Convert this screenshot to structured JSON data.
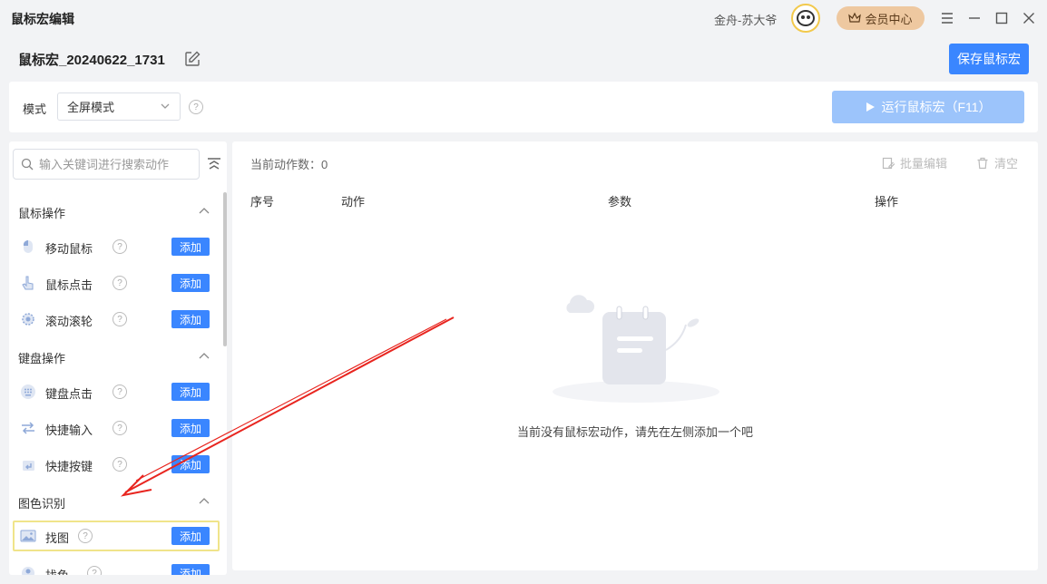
{
  "app": {
    "title": "鼠标宏编辑",
    "username": "金舟-苏大爷",
    "vip_label": "会员中心"
  },
  "header": {
    "macro_name": "鼠标宏_20240622_1731",
    "save_label": "保存鼠标宏"
  },
  "modebar": {
    "mode_label": "模式",
    "mode_value": "全屏模式",
    "run_label": "运行鼠标宏（F11）"
  },
  "sidebar": {
    "search_placeholder": "输入关键词进行搜索动作",
    "add_label": "添加",
    "groups": [
      {
        "title": "鼠标操作",
        "items": [
          {
            "label": "移动鼠标",
            "icon": "mouse-icon"
          },
          {
            "label": "鼠标点击",
            "icon": "pointer-hand-icon"
          },
          {
            "label": "滚动滚轮",
            "icon": "scroll-wheel-icon"
          }
        ]
      },
      {
        "title": "键盘操作",
        "items": [
          {
            "label": "键盘点击",
            "icon": "keyboard-icon"
          },
          {
            "label": "快捷输入",
            "icon": "quick-input-icon"
          },
          {
            "label": "快捷按键",
            "icon": "hotkey-icon"
          }
        ]
      },
      {
        "title": "图色识别",
        "items": [
          {
            "label": "找图",
            "icon": "image-icon"
          },
          {
            "label": "找色",
            "icon": "color-icon"
          }
        ]
      }
    ]
  },
  "main": {
    "count_label": "当前动作数：0",
    "batch_edit_label": "批量编辑",
    "clear_label": "清空",
    "columns": [
      "序号",
      "动作",
      "参数",
      "操作"
    ],
    "empty_text": "当前没有鼠标宏动作，请先在左侧添加一个吧"
  },
  "colors": {
    "primary": "#3a86ff",
    "primary_disabled": "#9cc4fb",
    "vip": "#eec8a0",
    "annotation_arrow": "#e8251f"
  }
}
